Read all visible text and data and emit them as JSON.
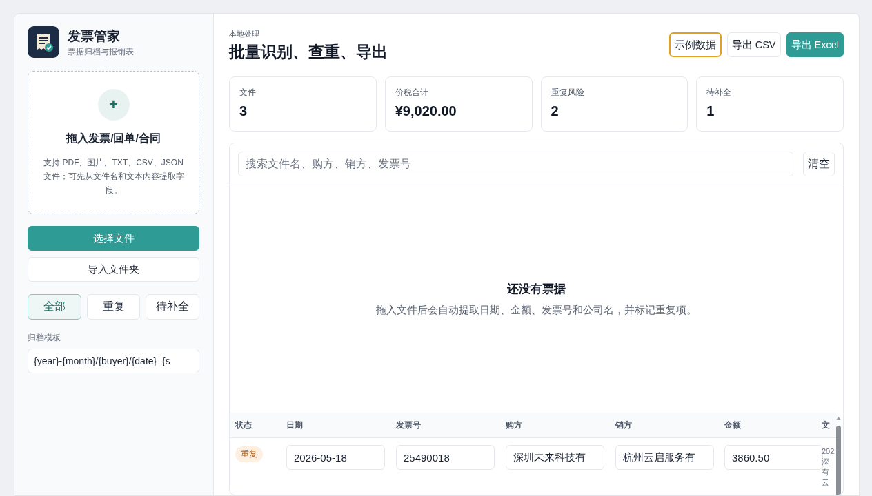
{
  "app": {
    "name": "发票管家",
    "subtitle": "票据归档与报销表"
  },
  "dropzone": {
    "icon": "+",
    "title": "拖入发票/回单/合同",
    "hint": "支持 PDF、图片、TXT、CSV、JSON 文件；可先从文件名和文本内容提取字段。"
  },
  "actions": [
    {
      "label": "选择文件",
      "kind": "primary"
    },
    {
      "label": "导入文件夹",
      "kind": "plain"
    }
  ],
  "filters": [
    {
      "label": "全部",
      "selected": true
    },
    {
      "label": "重复",
      "selected": false
    },
    {
      "label": "待补全",
      "selected": false
    }
  ],
  "template": {
    "label": "归档模板",
    "value": "{year}-{month}/{buyer}/{date}_{s"
  },
  "header": {
    "eyebrow": "本地处理",
    "title": "批量识别、查重、导出"
  },
  "header_buttons": [
    {
      "label": "示例数据",
      "kind": "focused"
    },
    {
      "label": "导出 CSV",
      "kind": "plain"
    },
    {
      "label": "导出 Excel",
      "kind": "primary"
    }
  ],
  "stats": [
    {
      "label": "文件",
      "value": "3"
    },
    {
      "label": "价税合计",
      "value": "¥9,020.00"
    },
    {
      "label": "重复风险",
      "value": "2"
    },
    {
      "label": "待补全",
      "value": "1"
    }
  ],
  "search": {
    "placeholder": "搜索文件名、购方、销方、发票号",
    "clear": "清空"
  },
  "empty": {
    "title": "还没有票据",
    "text": "拖入文件后会自动提取日期、金额、发票号和公司名，并标记重复项。"
  },
  "table": {
    "columns": [
      "状态",
      "日期",
      "发票号",
      "购方",
      "销方",
      "金额",
      "文"
    ],
    "rows": [
      {
        "status": {
          "label": "重复",
          "kind": "duplicate"
        },
        "date": "2026-05-18",
        "invoice": "25490018",
        "buyer": "深圳未来科技有",
        "seller": "杭州云启服务有",
        "amount": "3860.50",
        "file": [
          "202",
          "深",
          "有",
          "云"
        ]
      }
    ]
  }
}
